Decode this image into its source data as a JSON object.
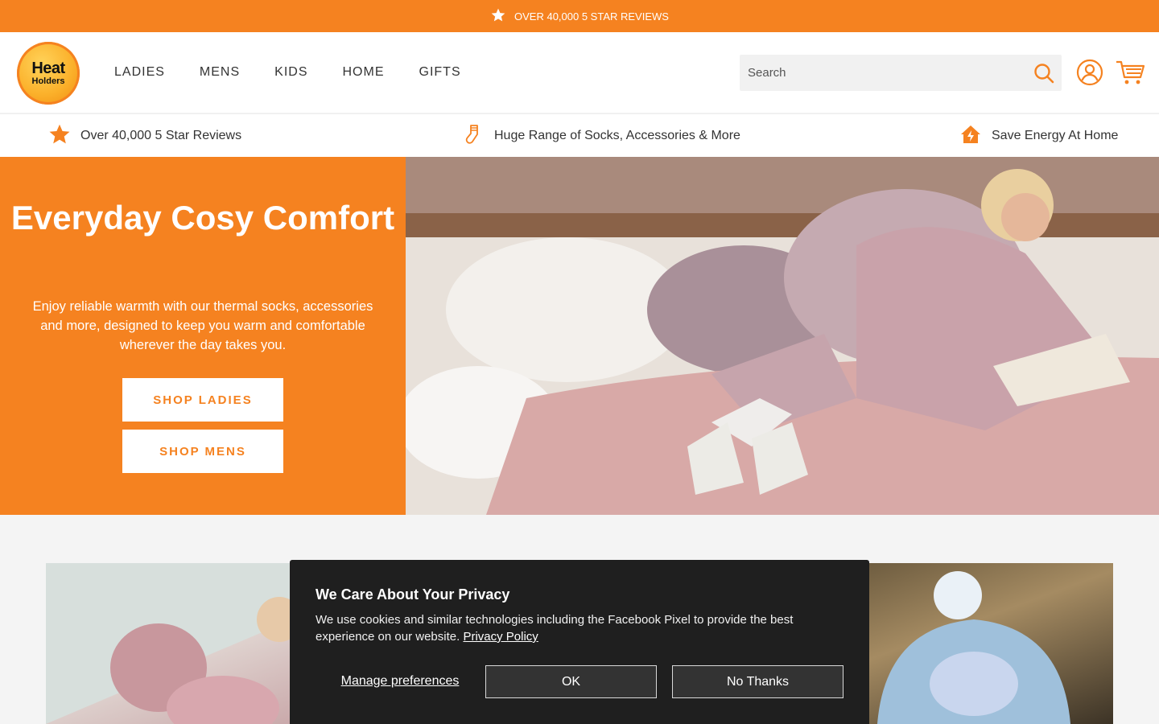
{
  "announcement": {
    "icon": "star-icon",
    "text": "OVER 40,000 5 STAR REVIEWS"
  },
  "brand": {
    "logo_line1": "Heat",
    "logo_line2": "Holders",
    "accent": "#f58220"
  },
  "nav": {
    "items": [
      "LADIES",
      "MENS",
      "KIDS",
      "HOME",
      "GIFTS"
    ]
  },
  "search": {
    "placeholder": "Search",
    "value": ""
  },
  "header_icons": [
    "search-icon",
    "account-icon",
    "cart-icon"
  ],
  "usp": [
    {
      "icon": "star-icon",
      "text": "Over 40,000 5 Star Reviews"
    },
    {
      "icon": "sock-icon",
      "text": "Huge Range of Socks, Accessories & More"
    },
    {
      "icon": "house-energy-icon",
      "text": "Save Energy At Home"
    }
  ],
  "hero": {
    "title": "Everyday Cosy Comfort",
    "description": "Enjoy reliable warmth with our thermal socks, accessories and more, designed to keep you warm and comfortable wherever the day takes you.",
    "button1": "SHOP LADIES",
    "button2": "SHOP MENS"
  },
  "cookie": {
    "title": "We Care About Your Privacy",
    "text": "We use cookies and similar technologies including the Facebook Pixel to provide the best experience on our website.",
    "link": "Privacy Policy",
    "manage": "Manage preferences",
    "ok": "OK",
    "no": "No Thanks"
  }
}
